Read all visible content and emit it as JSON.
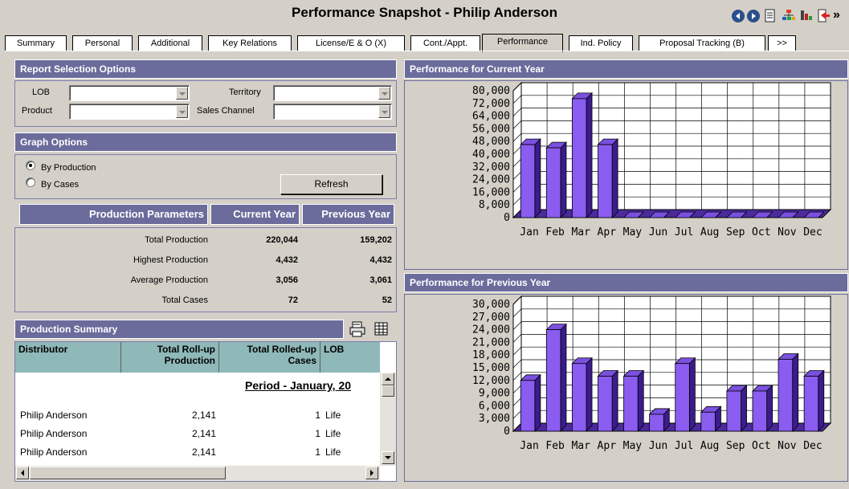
{
  "title": "Performance Snapshot - Philip Anderson",
  "tabs": [
    "Summary",
    "Personal",
    "Additional",
    "Key Relations",
    "License/E & O (X)",
    "Cont./Appt.",
    "Performance",
    "Ind. Policy",
    "Proposal Tracking (B)",
    ">>"
  ],
  "active_tab": "Performance",
  "report_selection": {
    "header": "Report Selection Options",
    "lob_label": "LOB",
    "territory_label": "Territory",
    "product_label": "Product",
    "sales_channel_label": "Sales Channel",
    "lob_value": "",
    "territory_value": "",
    "product_value": "",
    "sales_channel_value": ""
  },
  "graph_options": {
    "header": "Graph Options",
    "by_production": "By Production",
    "by_cases": "By Cases",
    "selected": "By Production",
    "refresh_label": "Refresh"
  },
  "production_params": {
    "header": "Production Parameters",
    "col_current": "Current Year",
    "col_previous": "Previous Year",
    "rows": [
      {
        "label": "Total Production",
        "current": "220,044",
        "previous": "159,202"
      },
      {
        "label": "Highest Production",
        "current": "4,432",
        "previous": "4,432"
      },
      {
        "label": "Average Production",
        "current": "3,056",
        "previous": "3,061"
      },
      {
        "label": "Total Cases",
        "current": "72",
        "previous": "52"
      }
    ]
  },
  "production_summary": {
    "header": "Production Summary",
    "columns": [
      "Distributor",
      "Total Roll-up Production",
      "Total Rolled-up Cases",
      "LOB"
    ],
    "period_label": "Period - January, 20",
    "rows": [
      {
        "distributor": "Philip Anderson",
        "production": "2,141",
        "cases": "1",
        "lob": "Life"
      },
      {
        "distributor": "Philip Anderson",
        "production": "2,141",
        "cases": "1",
        "lob": "Life"
      },
      {
        "distributor": "Philip Anderson",
        "production": "2,141",
        "cases": "1",
        "lob": "Life"
      }
    ]
  },
  "chart_data": [
    {
      "type": "bar",
      "title": "Performance for Current Year",
      "categories": [
        "Jan",
        "Feb",
        "Mar",
        "Apr",
        "May",
        "Jun",
        "Jul",
        "Aug",
        "Sep",
        "Oct",
        "Nov",
        "Dec"
      ],
      "values": [
        46000,
        44000,
        75000,
        46000,
        0,
        0,
        0,
        0,
        0,
        0,
        0,
        0
      ],
      "ylim": [
        0,
        80000
      ],
      "yticks": [
        "80,000",
        "72,000",
        "64,000",
        "56,000",
        "48,000",
        "40,000",
        "32,000",
        "24,000",
        "16,000",
        "8,000",
        "0"
      ],
      "grid": true,
      "color": "#8a5cf0"
    },
    {
      "type": "bar",
      "title": "Performance for Previous Year",
      "categories": [
        "Jan",
        "Feb",
        "Mar",
        "Apr",
        "May",
        "Jun",
        "Jul",
        "Aug",
        "Sep",
        "Oct",
        "Nov",
        "Dec"
      ],
      "values": [
        12000,
        24000,
        16000,
        13000,
        13000,
        4000,
        16000,
        4500,
        9500,
        9500,
        17000,
        13000
      ],
      "ylim": [
        0,
        30000
      ],
      "yticks": [
        "30,000",
        "27,000",
        "24,000",
        "21,000",
        "18,000",
        "15,000",
        "12,000",
        "9,000",
        "6,000",
        "3,000",
        "0"
      ],
      "grid": true,
      "color": "#8a5cf0"
    }
  ]
}
